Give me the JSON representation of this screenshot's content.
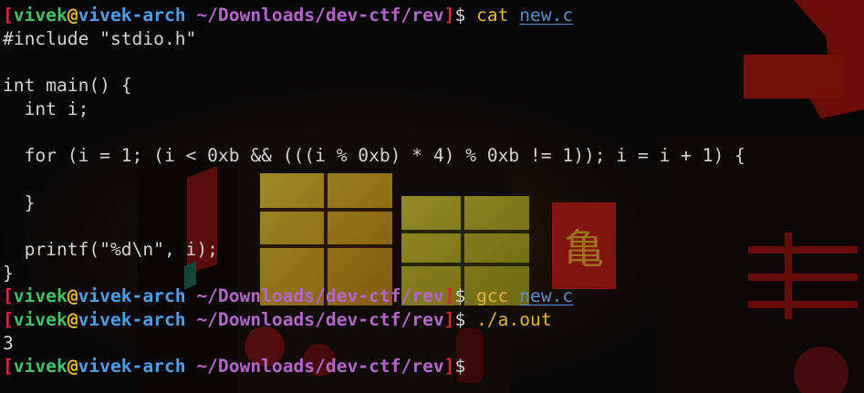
{
  "theme": {
    "bracket_color": "#e2243a",
    "user_color": "#43c26a",
    "at_color": "#e4b83a",
    "host_color": "#4da0e8",
    "path_color": "#b566c9",
    "command_color": "#e4b441",
    "argument_color": "#5b8fd0",
    "text_color": "#d4d4d4",
    "background_color": "#0b0b0d"
  },
  "wallpaper": {
    "sign_glyph": "亀"
  },
  "prompt": {
    "open_bracket": "[",
    "user": "vivek",
    "at": "@",
    "host": "vivek-arch",
    "path": " ~/Downloads/dev-ctf/rev",
    "close_bracket": "]",
    "dollar": "$ "
  },
  "session": [
    {
      "kind": "prompt",
      "command": "cat",
      "argument": "new.c"
    },
    {
      "kind": "code",
      "text": "#include \"stdio.h\""
    },
    {
      "kind": "code",
      "text": ""
    },
    {
      "kind": "code",
      "text": "int main() {"
    },
    {
      "kind": "code",
      "text": "  int i;"
    },
    {
      "kind": "code",
      "text": ""
    },
    {
      "kind": "code",
      "text": "  for (i = 1; (i < 0xb && (((i % 0xb) * 4) % 0xb != 1)); i = i + 1) {"
    },
    {
      "kind": "code",
      "text": ""
    },
    {
      "kind": "code",
      "text": "  }"
    },
    {
      "kind": "code",
      "text": ""
    },
    {
      "kind": "code",
      "text": "  printf(\"%d\\n\", i);"
    },
    {
      "kind": "code",
      "text": "}"
    },
    {
      "kind": "prompt",
      "command": "gcc",
      "argument": "new.c"
    },
    {
      "kind": "prompt",
      "command": "./a.out",
      "argument": ""
    },
    {
      "kind": "output",
      "text": "3"
    },
    {
      "kind": "prompt",
      "command": "",
      "argument": ""
    }
  ]
}
